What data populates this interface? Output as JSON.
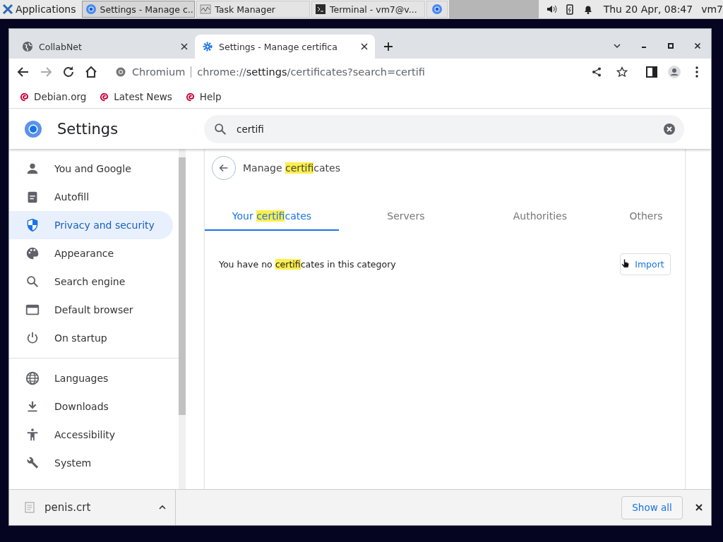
{
  "taskbar": {
    "menu_label": "Applications",
    "windows": [
      {
        "title": "Settings - Manage c...",
        "kind": "chromium",
        "selected": true
      },
      {
        "title": "Task Manager",
        "kind": "monitor",
        "selected": false
      },
      {
        "title": "Terminal - vm7@v...",
        "kind": "terminal",
        "selected": false
      },
      {
        "kind": "chromium",
        "selected": false
      }
    ],
    "clock": "Thu 20 Apr, 08:47",
    "user": "vm7"
  },
  "browser": {
    "tabs": [
      {
        "title": "CollabNet",
        "kind": "globe",
        "selected": false
      },
      {
        "title": "Settings - Manage certifica",
        "kind": "gear",
        "selected": true
      }
    ],
    "address": {
      "site": "Chromium",
      "scheme": "chrome://",
      "host": "settings",
      "path": "/certificates?search=certifi"
    },
    "bookmarks": [
      "Debian.org",
      "Latest News",
      "Help"
    ]
  },
  "settings": {
    "title": "Settings",
    "search": {
      "value": "certifi"
    },
    "nav_groups": [
      [
        {
          "label": "You and Google",
          "kind": "person",
          "selected": false
        },
        {
          "label": "Autofill",
          "kind": "clipboard",
          "selected": false
        },
        {
          "label": "Privacy and security",
          "kind": "shield",
          "selected": true
        },
        {
          "label": "Appearance",
          "kind": "palette",
          "selected": false
        },
        {
          "label": "Search engine",
          "kind": "search",
          "selected": false
        },
        {
          "label": "Default browser",
          "kind": "browser",
          "selected": false
        },
        {
          "label": "On startup",
          "kind": "power",
          "selected": false
        }
      ],
      [
        {
          "label": "Languages",
          "kind": "globe",
          "selected": false
        },
        {
          "label": "Downloads",
          "kind": "download",
          "selected": false
        },
        {
          "label": "Accessibility",
          "kind": "accessibility",
          "selected": false
        },
        {
          "label": "System",
          "kind": "wrench",
          "selected": false
        }
      ]
    ],
    "page": {
      "heading": [
        {
          "text": "Manage ",
          "highlighted": false
        },
        {
          "text": "certifi",
          "highlighted": true
        },
        {
          "text": "cates",
          "highlighted": false
        }
      ],
      "tabs": [
        {
          "label": [
            {
              "text": "Your ",
              "highlighted": false
            },
            {
              "text": "certifi",
              "highlighted": true
            },
            {
              "text": "cates",
              "highlighted": false
            }
          ],
          "selected": true
        },
        {
          "label": [
            {
              "text": "Servers",
              "highlighted": false
            }
          ],
          "selected": false
        },
        {
          "label": [
            {
              "text": "Authorities",
              "highlighted": false
            }
          ],
          "selected": false
        },
        {
          "label": [
            {
              "text": "Others",
              "highlighted": false
            }
          ],
          "selected": false
        }
      ],
      "message": [
        {
          "text": "You have no ",
          "highlighted": false
        },
        {
          "text": "certifi",
          "highlighted": true
        },
        {
          "text": "cates in this category",
          "highlighted": false
        }
      ],
      "import_button": "Import"
    }
  },
  "download_bar": {
    "file": "penis.crt",
    "show_all": "Show all"
  }
}
